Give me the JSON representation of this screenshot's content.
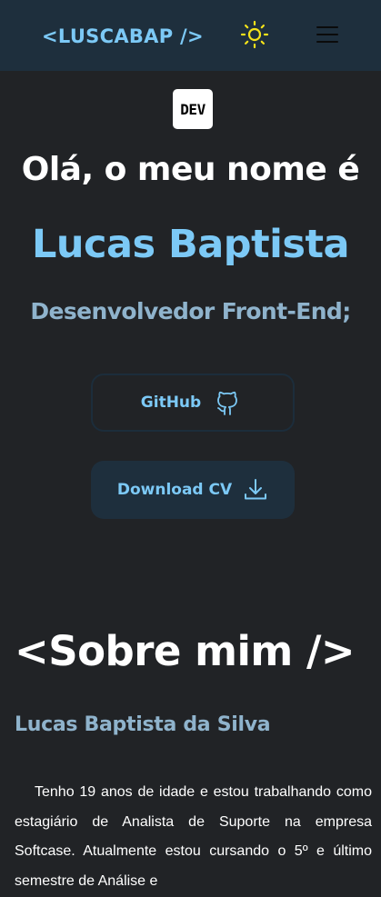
{
  "navbar": {
    "logo": "<LUSCABAP />",
    "theme_icon": "sun-icon",
    "menu_icon": "hamburger-menu-icon"
  },
  "hero": {
    "badge_text": "DEV",
    "greeting": "Olá, o meu nome é",
    "name": "Lucas Baptista",
    "role": "Desenvolvedor Front-End;",
    "github_label": "GitHub",
    "github_icon": "github-icon",
    "download_label": "Download CV",
    "download_icon": "download-icon"
  },
  "about": {
    "title": "<Sobre mim />",
    "name": "Lucas Baptista da Silva",
    "text": "Tenho 19 anos de idade e estou trabalhando como estagiário de Analista de Suporte na empresa Softcase. Atualmente estou cursando o 5º e último semestre de Análise e"
  },
  "colors": {
    "background": "#212326",
    "navbar": "#1e2f3d",
    "accent": "#7cc9f6",
    "muted_accent": "#8fb3cc",
    "sun": "#f4e21a"
  }
}
